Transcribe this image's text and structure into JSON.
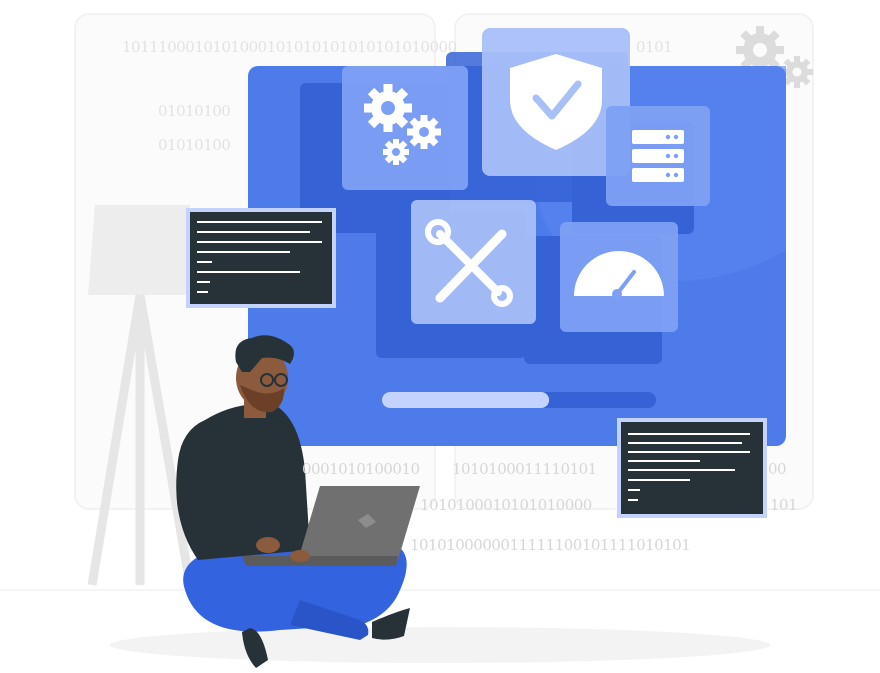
{
  "binary": {
    "line1": "1011100010101000101010101010101010000",
    "line1b": "0101",
    "line2": "01010100",
    "line3": "01010100",
    "line4": "0001010100010",
    "line4b": "1010100011110101",
    "line4c": "00",
    "line5": "1010100010101010000",
    "line5b": "101",
    "line6": "1010100000011111100101111010101"
  },
  "progress": {
    "fraction": 0.61
  },
  "colors": {
    "screen": "#4d7bea",
    "screen_dark": "#3563d6",
    "tile": "#7ea0f4",
    "tile_light": "#a8bff8",
    "terminal": "#263238",
    "shirt": "#263238",
    "pants": "#3463e0",
    "laptop": "#707070"
  },
  "icons": [
    "gears-icon",
    "shield-check-icon",
    "server-icon",
    "tools-icon",
    "gauge-icon",
    "laptop-icon"
  ]
}
